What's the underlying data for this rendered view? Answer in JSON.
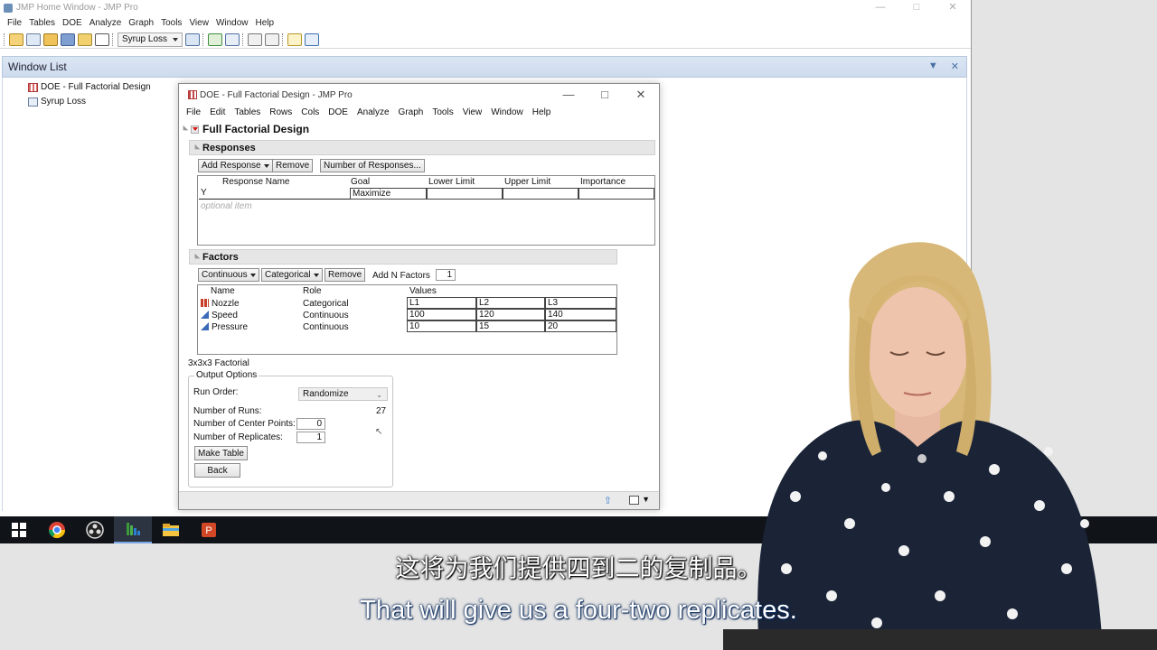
{
  "home": {
    "title": "JMP Home Window - JMP Pro",
    "menu": [
      "File",
      "Tables",
      "DOE",
      "Analyze",
      "Graph",
      "Tools",
      "View",
      "Window",
      "Help"
    ],
    "toolbar_table": "Syrup Loss",
    "window_list": {
      "title": "Window List",
      "items": [
        "DOE - Full Factorial Design",
        "Syrup Loss"
      ]
    }
  },
  "doe": {
    "title": "DOE - Full Factorial Design - JMP Pro",
    "menu": [
      "File",
      "Edit",
      "Tables",
      "Rows",
      "Cols",
      "DOE",
      "Analyze",
      "Graph",
      "Tools",
      "View",
      "Window",
      "Help"
    ],
    "platform_title": "Full Factorial Design",
    "responses": {
      "title": "Responses",
      "buttons": [
        "Add Response",
        "Remove",
        "Number of Responses..."
      ],
      "headers": [
        "Response Name",
        "Goal",
        "Lower Limit",
        "Upper Limit",
        "Importance"
      ],
      "rows": [
        {
          "name": "Y",
          "goal": "Maximize",
          "lower": "",
          "upper": "",
          "importance": ""
        }
      ],
      "optional": "optional item"
    },
    "factors": {
      "title": "Factors",
      "buttons": [
        "Continuous",
        "Categorical",
        "Remove"
      ],
      "add_n_label": "Add N Factors",
      "add_n_value": "1",
      "headers": [
        "Name",
        "Role",
        "Values"
      ],
      "rows": [
        {
          "name": "Nozzle",
          "role": "Categorical",
          "values": [
            "L1",
            "L2",
            "L3"
          ]
        },
        {
          "name": "Speed",
          "role": "Continuous",
          "values": [
            "100",
            "120",
            "140"
          ]
        },
        {
          "name": "Pressure",
          "role": "Continuous",
          "values": [
            "10",
            "15",
            "20"
          ]
        }
      ]
    },
    "design_label": "3x3x3 Factorial",
    "output_options": {
      "title": "Output Options",
      "run_order_label": "Run Order:",
      "run_order_value": "Randomize",
      "runs_label": "Number of Runs:",
      "runs_value": "27",
      "center_label": "Number of Center Points:",
      "center_value": "0",
      "replicates_label": "Number of Replicates:",
      "replicates_value": "1",
      "make_table": "Make Table",
      "back": "Back"
    }
  },
  "subtitles": {
    "zh": "这将为我们提供四到二的复制品。",
    "en": "That will give us a four-two replicates."
  }
}
